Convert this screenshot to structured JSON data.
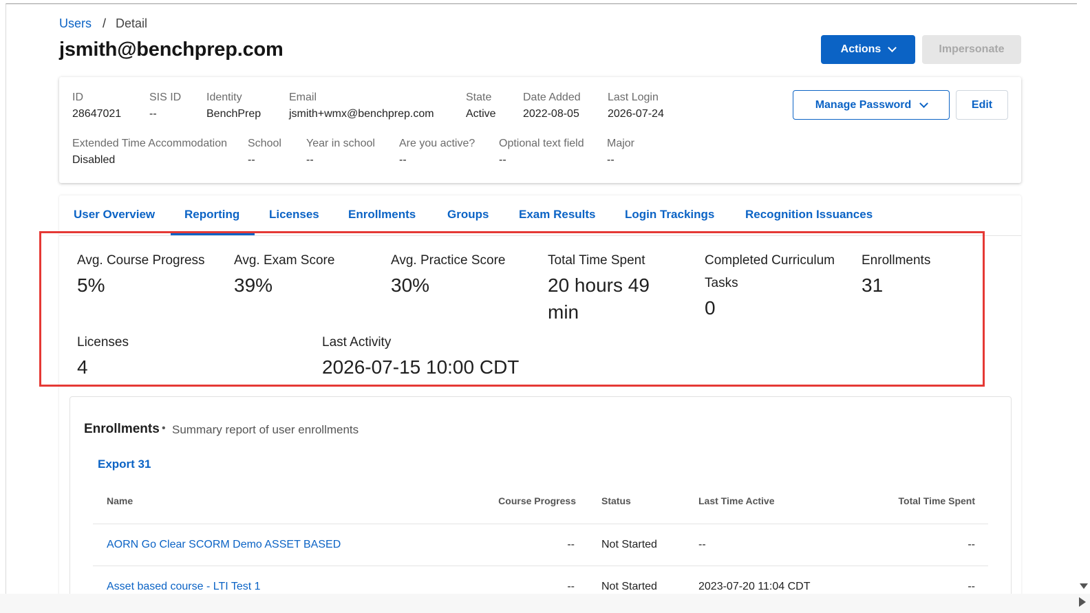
{
  "breadcrumb": {
    "parent": "Users",
    "separator": "/",
    "current": "Detail"
  },
  "page_title": "jsmith@benchprep.com",
  "header_actions": {
    "actions_label": "Actions",
    "impersonate_label": "Impersonate"
  },
  "user_info": {
    "row1": [
      {
        "label": "ID",
        "value": "28647021"
      },
      {
        "label": "SIS ID",
        "value": "--"
      },
      {
        "label": "Identity",
        "value": "BenchPrep"
      },
      {
        "label": "Email",
        "value": "jsmith+wmx@benchprep.com"
      },
      {
        "label": "State",
        "value": "Active"
      },
      {
        "label": "Date Added",
        "value": "2022-08-05"
      },
      {
        "label": "Last Login",
        "value": "2026-07-24"
      }
    ],
    "row2": [
      {
        "label": "Extended Time Accommodation",
        "value": "Disabled"
      },
      {
        "label": "School",
        "value": "--"
      },
      {
        "label": "Year in school",
        "value": "--"
      },
      {
        "label": "Are you active?",
        "value": "--"
      },
      {
        "label": "Optional text field",
        "value": "--"
      },
      {
        "label": "Major",
        "value": "--"
      }
    ],
    "manage_password_label": "Manage Password",
    "edit_label": "Edit"
  },
  "tabs": [
    {
      "label": "User Overview"
    },
    {
      "label": "Reporting",
      "active": true
    },
    {
      "label": "Licenses"
    },
    {
      "label": "Enrollments"
    },
    {
      "label": "Groups"
    },
    {
      "label": "Exam Results"
    },
    {
      "label": "Login Trackings"
    },
    {
      "label": "Recognition Issuances"
    }
  ],
  "stats": {
    "row1": [
      {
        "label": "Avg. Course Progress",
        "value": "5%"
      },
      {
        "label": "Avg. Exam Score",
        "value": "39%"
      },
      {
        "label": "Avg. Practice Score",
        "value": "30%"
      },
      {
        "label": "Total Time Spent",
        "value": "20 hours 49 min"
      },
      {
        "label": "Completed Curriculum Tasks",
        "value": "0"
      },
      {
        "label": "Enrollments",
        "value": "31"
      }
    ],
    "row2": [
      {
        "label": "Licenses",
        "value": "4"
      },
      {
        "label": "Last Activity",
        "value": "2026-07-15 10:00 CDT"
      }
    ]
  },
  "enrollments": {
    "title": "Enrollments",
    "dot": "•",
    "subtitle": "Summary report of user enrollments",
    "export_label": "Export 31",
    "columns": [
      "Name",
      "Course Progress",
      "Status",
      "Last Time Active",
      "Total Time Spent"
    ],
    "rows": [
      [
        "AORN Go Clear SCORM Demo ASSET BASED",
        "--",
        "Not Started",
        "--",
        "--"
      ],
      [
        "Asset based course - LTI Test 1",
        "--",
        "Not Started",
        "2023-07-20 11:04 CDT",
        "--"
      ]
    ]
  },
  "colors": {
    "accent": "#0b63c5",
    "highlight": "#e53935",
    "disabled_bg": "#e6e6e6"
  }
}
